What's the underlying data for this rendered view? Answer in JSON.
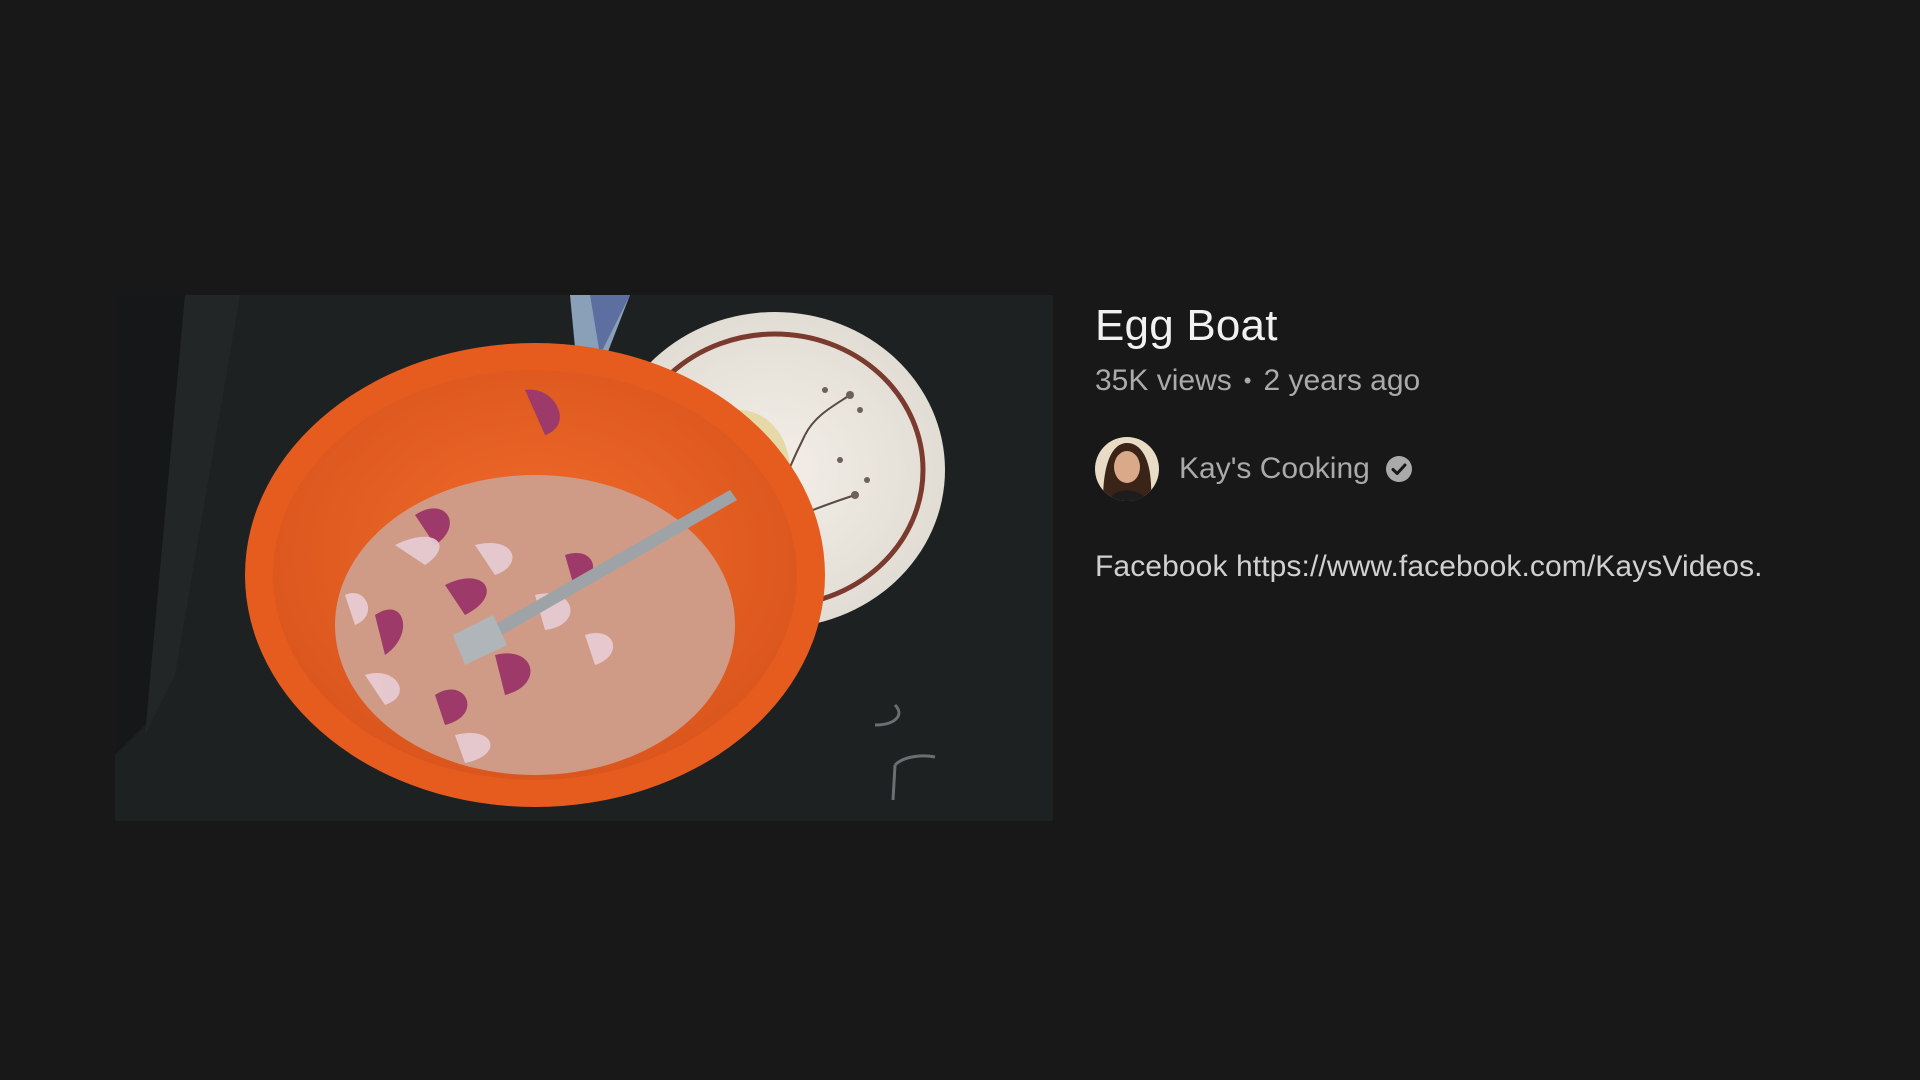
{
  "video": {
    "title": "Egg Boat",
    "views": "35K views",
    "separator": "•",
    "age": "2 years ago",
    "channel": {
      "name": "Kay's Cooking",
      "verified_icon": "verified-check-icon"
    },
    "description": "Facebook https://www.facebook.com/KaysVideos."
  },
  "colors": {
    "background": "#181818",
    "title": "#f1f1f1",
    "secondary_text": "#aaaaaa"
  }
}
